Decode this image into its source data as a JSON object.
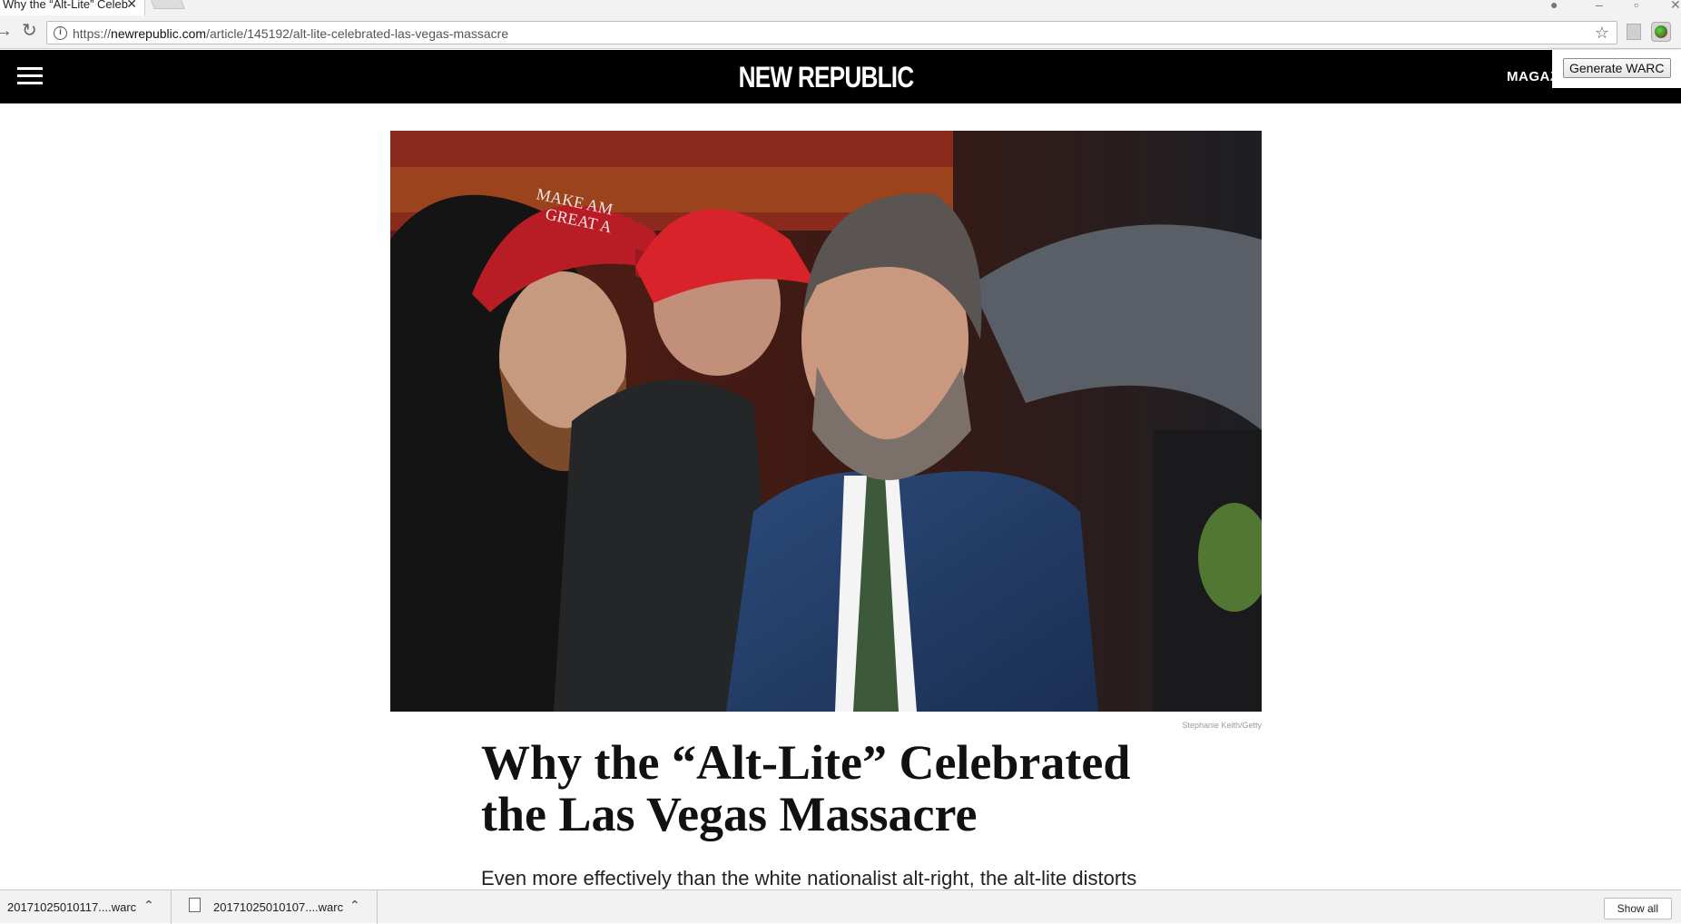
{
  "browser": {
    "tab_title": "Why the “Alt-Lite” Celeb",
    "tab_close": "✕",
    "url_domain": "newrepublic.com",
    "url_prefix": "https://",
    "url_path": "/article/145192/alt-lite-celebrated-las-vegas-massacre",
    "forward_glyph": "→",
    "reload_glyph": "↻",
    "star_glyph": "☆"
  },
  "extension": {
    "generate_warc_label": "Generate WARC"
  },
  "site": {
    "logo": "NEW REPUBLIC",
    "nav_magazine": "MAGAZ"
  },
  "article": {
    "image_credit": "Stephanie Keith/Getty",
    "headline": "Why the “Alt-Lite” Celebrated the Las Vegas Massacre",
    "dek": "Even more effectively than the white nationalist alt-right, the alt-lite distorts"
  },
  "downloads": {
    "items": [
      {
        "name": "20171025010117....warc"
      },
      {
        "name": "20171025010107....warc"
      }
    ],
    "show_all_label": "Show all"
  }
}
